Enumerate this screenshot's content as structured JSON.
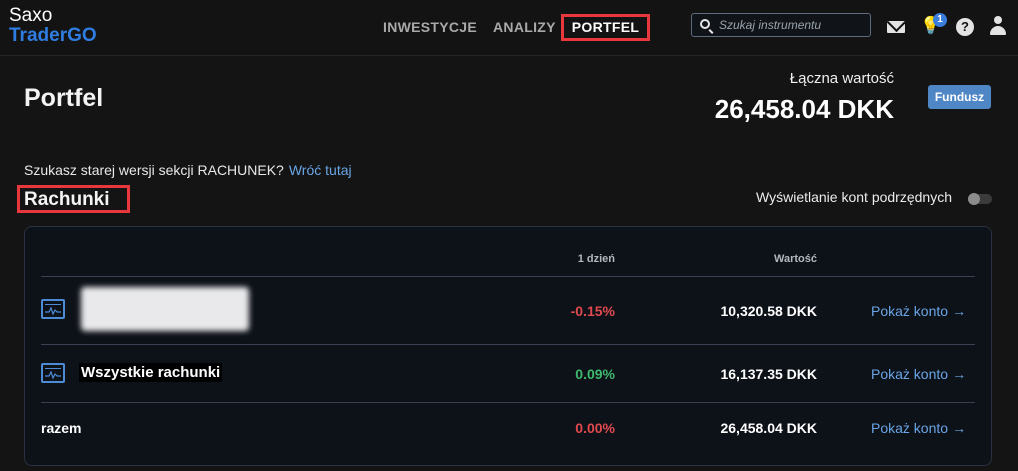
{
  "brand": {
    "line1": "Saxo",
    "line2": "TraderGO",
    "accent": "#2f7de1"
  },
  "nav": {
    "tabs": [
      {
        "label": "INWESTYCJE"
      },
      {
        "label": "ANALIZY"
      },
      {
        "label": "PORTFEL"
      }
    ],
    "active": "PORTFEL"
  },
  "search": {
    "placeholder": "Szukaj instrumentu",
    "icon": "search-icon"
  },
  "header_icons": {
    "mail": "mail-icon",
    "notifications": "lightbulb-icon",
    "notification_count": "1",
    "help": "help-icon",
    "help_glyph": "?",
    "profile": "user-icon"
  },
  "page": {
    "title": "Portfel",
    "total_label": "Łączna wartość",
    "total_value": "26,458.04 DKK",
    "fund_button": "Fundusz"
  },
  "old_version": {
    "text": "Szukasz starej wersji sekcji RACHUNEK?",
    "link": "Wróć tutaj"
  },
  "accounts": {
    "title": "Rachunki",
    "subaccounts_label": "Wyświetlanie kont podrzędnych",
    "subaccounts_on": false,
    "columns": {
      "day": "1 dzień",
      "value": "Wartość"
    },
    "rows": [
      {
        "name": "",
        "day": "-0.15%",
        "value": "10,320.58 DKK",
        "action": "Pokaż konto",
        "icon": "chart-icon"
      },
      {
        "name": "Wszystkie rachunki",
        "day": "0.09%",
        "value": "16,137.35 DKK",
        "action": "Pokaż konto",
        "icon": "chart-icon"
      }
    ],
    "total": {
      "name": "razem",
      "day": "0.00%",
      "value": "26,458.04 DKK",
      "action": "Pokaż konto"
    },
    "arrow": "→"
  },
  "colors": {
    "negative": "#e04a4f",
    "positive": "#3fb96e",
    "link": "#6aa5e6",
    "highlight": "#e8383d"
  }
}
